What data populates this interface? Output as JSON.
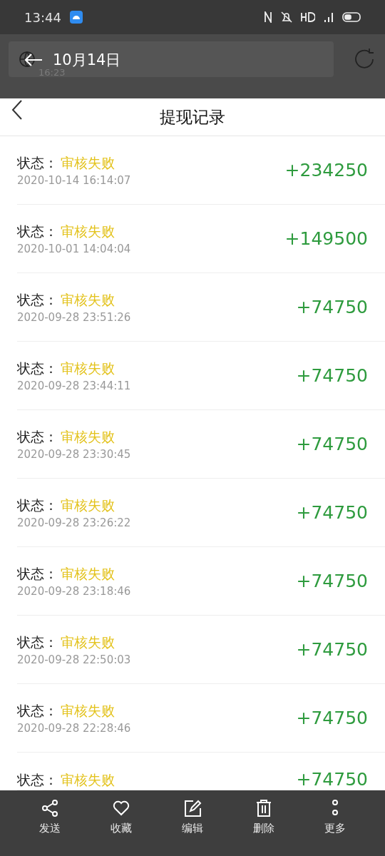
{
  "status_bar": {
    "time": "13:44"
  },
  "viewer_header": {
    "title": "10月14日",
    "subtitle": "16:23"
  },
  "page": {
    "title": "提现记录"
  },
  "records": [
    {
      "label": "状态：",
      "status": "审核失败",
      "date": "2020-10-14 16:14:07",
      "amount": "+234250"
    },
    {
      "label": "状态：",
      "status": "审核失败",
      "date": "2020-10-01 14:04:04",
      "amount": "+149500"
    },
    {
      "label": "状态：",
      "status": "审核失败",
      "date": "2020-09-28 23:51:26",
      "amount": "+74750"
    },
    {
      "label": "状态：",
      "status": "审核失败",
      "date": "2020-09-28 23:44:11",
      "amount": "+74750"
    },
    {
      "label": "状态：",
      "status": "审核失败",
      "date": "2020-09-28 23:30:45",
      "amount": "+74750"
    },
    {
      "label": "状态：",
      "status": "审核失败",
      "date": "2020-09-28 23:26:22",
      "amount": "+74750"
    },
    {
      "label": "状态：",
      "status": "审核失败",
      "date": "2020-09-28 23:18:46",
      "amount": "+74750"
    },
    {
      "label": "状态：",
      "status": "审核失败",
      "date": "2020-09-28 22:50:03",
      "amount": "+74750"
    },
    {
      "label": "状态：",
      "status": "审核失败",
      "date": "2020-09-28 22:28:46",
      "amount": "+74750"
    },
    {
      "label": "状态：",
      "status": "审核失败",
      "amount": "+74750"
    }
  ],
  "actions": [
    {
      "kind": "share",
      "label": "发送"
    },
    {
      "kind": "favorite",
      "label": "收藏"
    },
    {
      "kind": "edit",
      "label": "编辑"
    },
    {
      "kind": "delete",
      "label": "删除"
    },
    {
      "kind": "more",
      "label": "更多"
    }
  ]
}
